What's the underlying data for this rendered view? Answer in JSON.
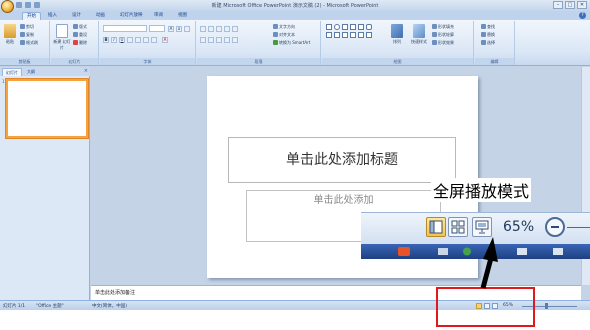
{
  "window": {
    "title": "新建 Microsoft Office PowerPoint 演示文稿 (2) - Microsoft PowerPoint",
    "minimize": "–",
    "maximize": "□",
    "close": "✕"
  },
  "tabs": [
    "开始",
    "插入",
    "设计",
    "动画",
    "幻灯片放映",
    "审阅",
    "视图"
  ],
  "active_tab": "开始",
  "ribbon": {
    "paste": "粘贴",
    "cut": "剪切",
    "copy": "复制",
    "format_painter": "格式刷",
    "new_slide": "新建\n幻灯片",
    "layout": "版式",
    "reset": "重设",
    "delete": "删除",
    "text_direction": "文字方向",
    "align_text": "对齐文本",
    "smartart": "转换为 SmartArt",
    "arrange": "排列",
    "quick_styles": "快速样式",
    "shape_fill": "形状填充",
    "shape_outline": "形状轮廓",
    "shape_effects": "形状效果",
    "find": "查找",
    "replace": "替换",
    "select": "选择",
    "groups": {
      "clipboard": "剪贴板",
      "slides": "幻灯片",
      "font": "字体",
      "paragraph": "段落",
      "drawing": "绘图",
      "editing": "编辑"
    }
  },
  "panel": {
    "tab_slides": "幻灯片",
    "tab_outline": "大纲",
    "close": "×",
    "thumb_number": "1"
  },
  "slide": {
    "title_placeholder": "单击此处添加标题",
    "subtitle_placeholder": "单击此处添加"
  },
  "notes": {
    "placeholder": "单击此处添加备注"
  },
  "status": {
    "slide_count": "幻灯片 1/1",
    "theme": "\"Office 主题\"",
    "language": "中文(简体，中国)",
    "zoom": "65%"
  },
  "callout": {
    "zoom": "65%",
    "label": "全屏播放模式"
  },
  "colors": {
    "thumb_border": "#f7a23c",
    "highlight_box": "#e0191c",
    "active_view_button": "#f6c34c"
  },
  "icons": [
    "office-button-icon",
    "normal-view-icon",
    "slide-sorter-icon",
    "slideshow-icon",
    "zoom-out-icon"
  ]
}
